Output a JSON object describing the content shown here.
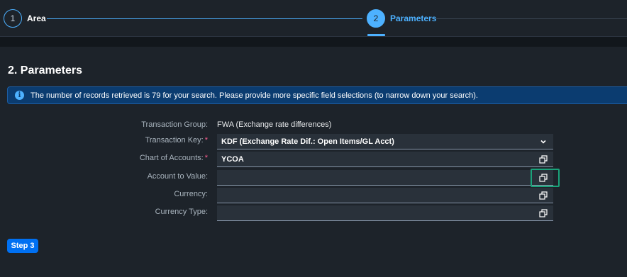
{
  "wizard": {
    "steps": [
      {
        "number": "1",
        "label": "Area",
        "state": "done"
      },
      {
        "number": "2",
        "label": "Parameters",
        "state": "active"
      }
    ]
  },
  "section": {
    "title": "2. Parameters"
  },
  "message": {
    "icon": "info-icon",
    "text": "The number of records retrieved is 79 for your search. Please provide more specific field selections (to narrow down your search)."
  },
  "form": {
    "transaction_group": {
      "label": "Transaction Group:",
      "value": "FWA (Exchange rate differences)"
    },
    "transaction_key": {
      "label": "Transaction Key:",
      "value": "KDF (Exchange Rate Dif.: Open Items/GL Acct)",
      "required": true,
      "icon": "chevron-down-icon"
    },
    "chart_of_accounts": {
      "label": "Chart of Accounts:",
      "value": "YCOA",
      "required": true,
      "icon": "value-help-icon"
    },
    "account_to_value": {
      "label": "Account to Value:",
      "value": "",
      "icon": "value-help-icon"
    },
    "currency": {
      "label": "Currency:",
      "value": "",
      "icon": "value-help-icon"
    },
    "currency_type": {
      "label": "Currency Type:",
      "value": "",
      "icon": "value-help-icon"
    }
  },
  "footer": {
    "next_step_label": "Step 3"
  },
  "colors": {
    "background": "#1d232a",
    "accent": "#4db1ff",
    "info_strip": "#0b3c70",
    "required": "#ff5e91",
    "highlight": "#1aa37a",
    "button": "#0070f2"
  }
}
